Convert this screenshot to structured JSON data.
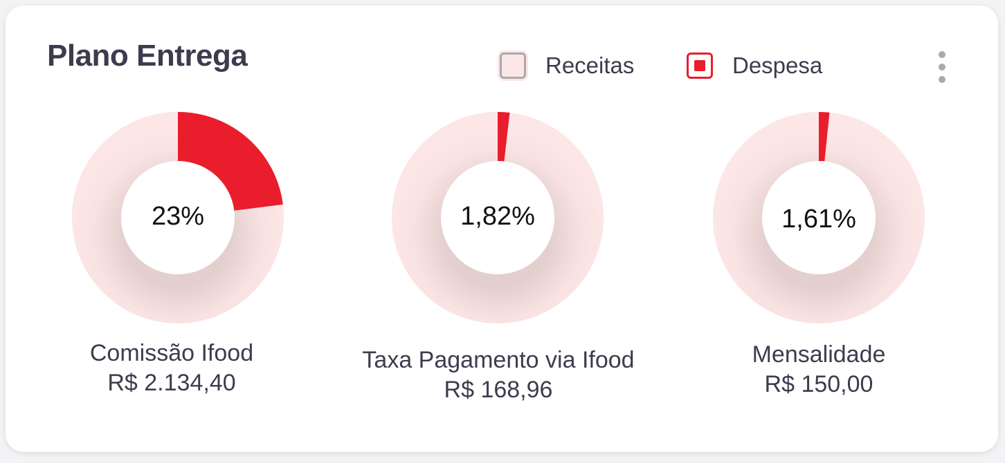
{
  "card": {
    "title": "Plano Entrega"
  },
  "legend": {
    "items": [
      {
        "label": "Receitas",
        "color": "#fde6e6"
      },
      {
        "label": "Despesa",
        "color": "#ea1d2c"
      }
    ]
  },
  "menu": {
    "icon": "more-vertical-icon"
  },
  "chart_data": {
    "type": "pie",
    "style": "donut",
    "legend": [
      "Receitas",
      "Despesa"
    ],
    "colors": {
      "receitas": "#fde6e6",
      "despesa": "#ea1d2c"
    },
    "charts": [
      {
        "label": "Comissão Ifood",
        "amount": "R$ 2.134,40",
        "percent": 23,
        "percent_text": "23%"
      },
      {
        "label": "Taxa Pagamento via Ifood",
        "amount": "R$ 168,96",
        "percent": 1.82,
        "percent_text": "1,82%"
      },
      {
        "label": "Mensalidade",
        "amount": "R$ 150,00",
        "percent": 1.61,
        "percent_text": "1,61%"
      }
    ]
  }
}
